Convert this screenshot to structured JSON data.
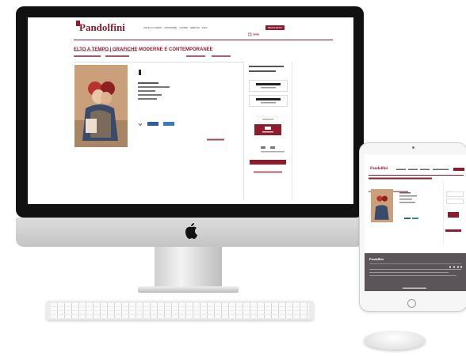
{
  "scene": {
    "description_devices": [
      "imac",
      "ipad",
      "keyboard",
      "mouse"
    ]
  },
  "site": {
    "logo": "Pandolfini",
    "nav": [
      "ASTE IN CORSO",
      "PROSSIME",
      "GIORNI",
      "SERVIZI",
      "INFO"
    ],
    "cta": "REGISTRATI",
    "title": "ELTO A TEMPO | GRAFICHE MODERNE E CONTEMPORANEE"
  },
  "colors": {
    "brand": "#8c1c2e",
    "footer": "#5b5559",
    "share_button": "#2d5fa8"
  }
}
